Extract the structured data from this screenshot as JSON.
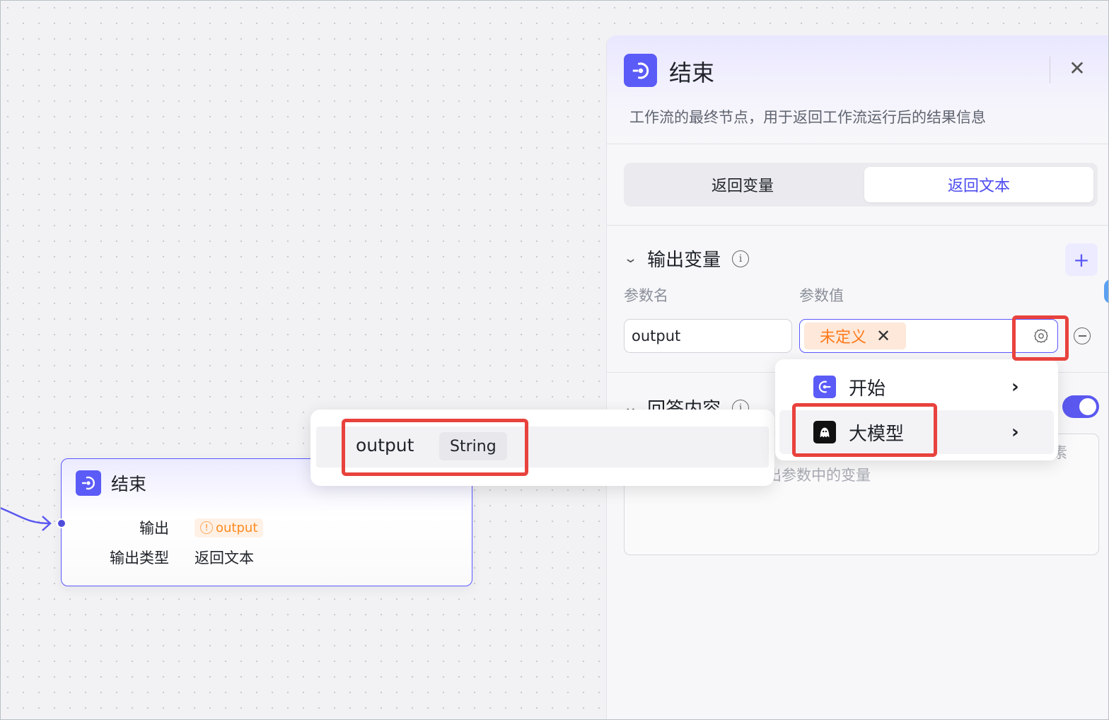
{
  "node": {
    "title": "结束",
    "rows": [
      {
        "label": "输出",
        "value": "output"
      },
      {
        "label": "输出类型",
        "value": "返回文本"
      }
    ]
  },
  "panel": {
    "title": "结束",
    "description": "工作流的最终节点，用于返回工作流运行后的结果信息",
    "tabs": [
      {
        "label": "返回变量",
        "active": false
      },
      {
        "label": "返回文本",
        "active": true
      }
    ],
    "output_section": {
      "title": "输出变量",
      "col_name": "参数名",
      "col_value": "参数值",
      "param_name": "output",
      "param_value_tag": "未定义"
    },
    "answer_section": {
      "title": "回答内容",
      "placeholder_tail": "素",
      "placeholder_line2": "出参数中的变量",
      "toggle_on": true
    }
  },
  "dropdown": {
    "items": [
      {
        "label": "开始",
        "icon": "start-node-icon"
      },
      {
        "label": "大模型",
        "icon": "llm-model-icon"
      }
    ]
  },
  "variable_popup": {
    "name": "output",
    "type": "String"
  },
  "colors": {
    "accent": "#5b58f5",
    "warning": "#ff8a1f",
    "highlight": "#e8423d"
  }
}
